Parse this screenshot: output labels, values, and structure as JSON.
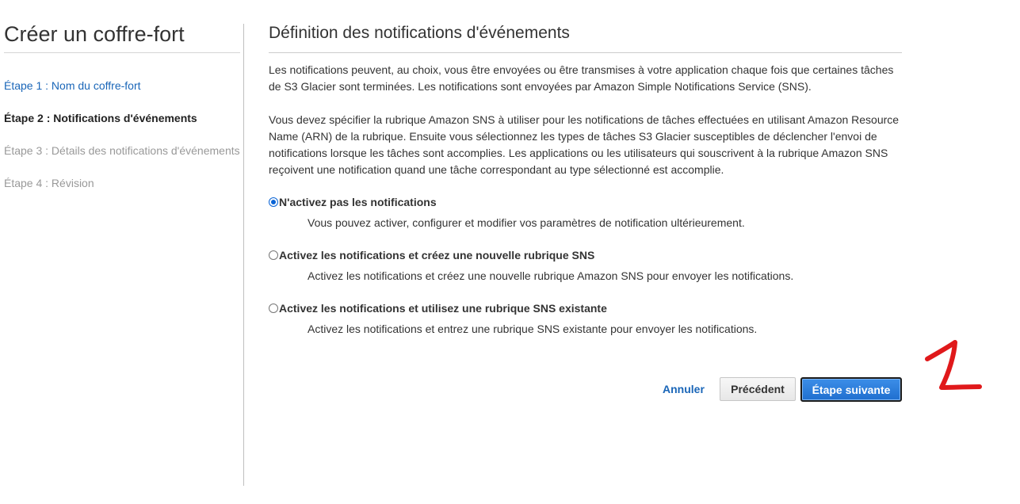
{
  "sidebar": {
    "title": "Créer un coffre-fort",
    "steps": [
      {
        "label": "Étape 1 : Nom du coffre-fort",
        "state": "link"
      },
      {
        "label": "Étape 2 : Notifications d'événements",
        "state": "current"
      },
      {
        "label": "Étape 3 : Détails des notifications d'événements",
        "state": "disabled"
      },
      {
        "label": "Étape 4 : Révision",
        "state": "disabled"
      }
    ]
  },
  "main": {
    "title": "Définition des notifications d'événements",
    "paragraph1": "Les notifications peuvent, au choix, vous être envoyées ou être transmises à votre application chaque fois que certaines tâches de S3 Glacier sont terminées. Les notifications sont envoyées par Amazon Simple Notifications Service (SNS).",
    "paragraph2": "Vous devez spécifier la rubrique Amazon SNS à utiliser pour les notifications de tâches effectuées en utilisant Amazon Resource Name (ARN) de la rubrique. Ensuite vous sélectionnez les types de tâches S3 Glacier susceptibles de déclencher l'envoi de notifications lorsque les tâches sont accomplies. Les applications ou les utilisateurs qui souscrivent à la rubrique Amazon SNS reçoivent une notification quand une tâche correspondant au type sélectionné est accomplie.",
    "options": [
      {
        "label": "N'activez pas les notifications",
        "description": "Vous pouvez activer, configurer et modifier vos paramètres de notification ultérieurement.",
        "checked": true
      },
      {
        "label": "Activez les notifications et créez une nouvelle rubrique SNS",
        "description": "Activez les notifications et créez une nouvelle rubrique Amazon SNS pour envoyer les notifications.",
        "checked": false
      },
      {
        "label": "Activez les notifications et utilisez une rubrique SNS existante",
        "description": "Activez les notifications et entrez une rubrique SNS existante pour envoyer les notifications.",
        "checked": false
      }
    ]
  },
  "footer": {
    "cancel_label": "Annuler",
    "previous_label": "Précédent",
    "next_label": "Étape suivante"
  },
  "colors": {
    "link": "#1a66b8",
    "primary_button": "#1f6fcf",
    "annotation": "#e0191b"
  },
  "annotation": {
    "icon": "handwritten-number-one"
  }
}
